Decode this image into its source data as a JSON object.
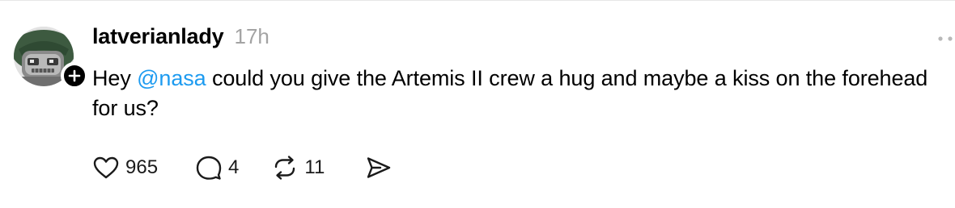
{
  "post": {
    "author": {
      "username": "latverianlady",
      "timestamp": "17h",
      "avatar_icon": "robot-avatar"
    },
    "text": {
      "before_mention": "Hey ",
      "mention": "@nasa",
      "after_mention": " could you give the Artemis II crew a hug and maybe a kiss on the forehead for us?"
    },
    "actions": {
      "like_count": "965",
      "reply_count": "4",
      "repost_count": "11"
    }
  },
  "colors": {
    "mention": "#1d9bf0",
    "timestamp": "#a3a3a3",
    "follow_badge": "#000000"
  },
  "icons": [
    "plus-icon",
    "more-dots-icon",
    "heart-icon",
    "comment-icon",
    "repost-icon",
    "share-icon"
  ]
}
